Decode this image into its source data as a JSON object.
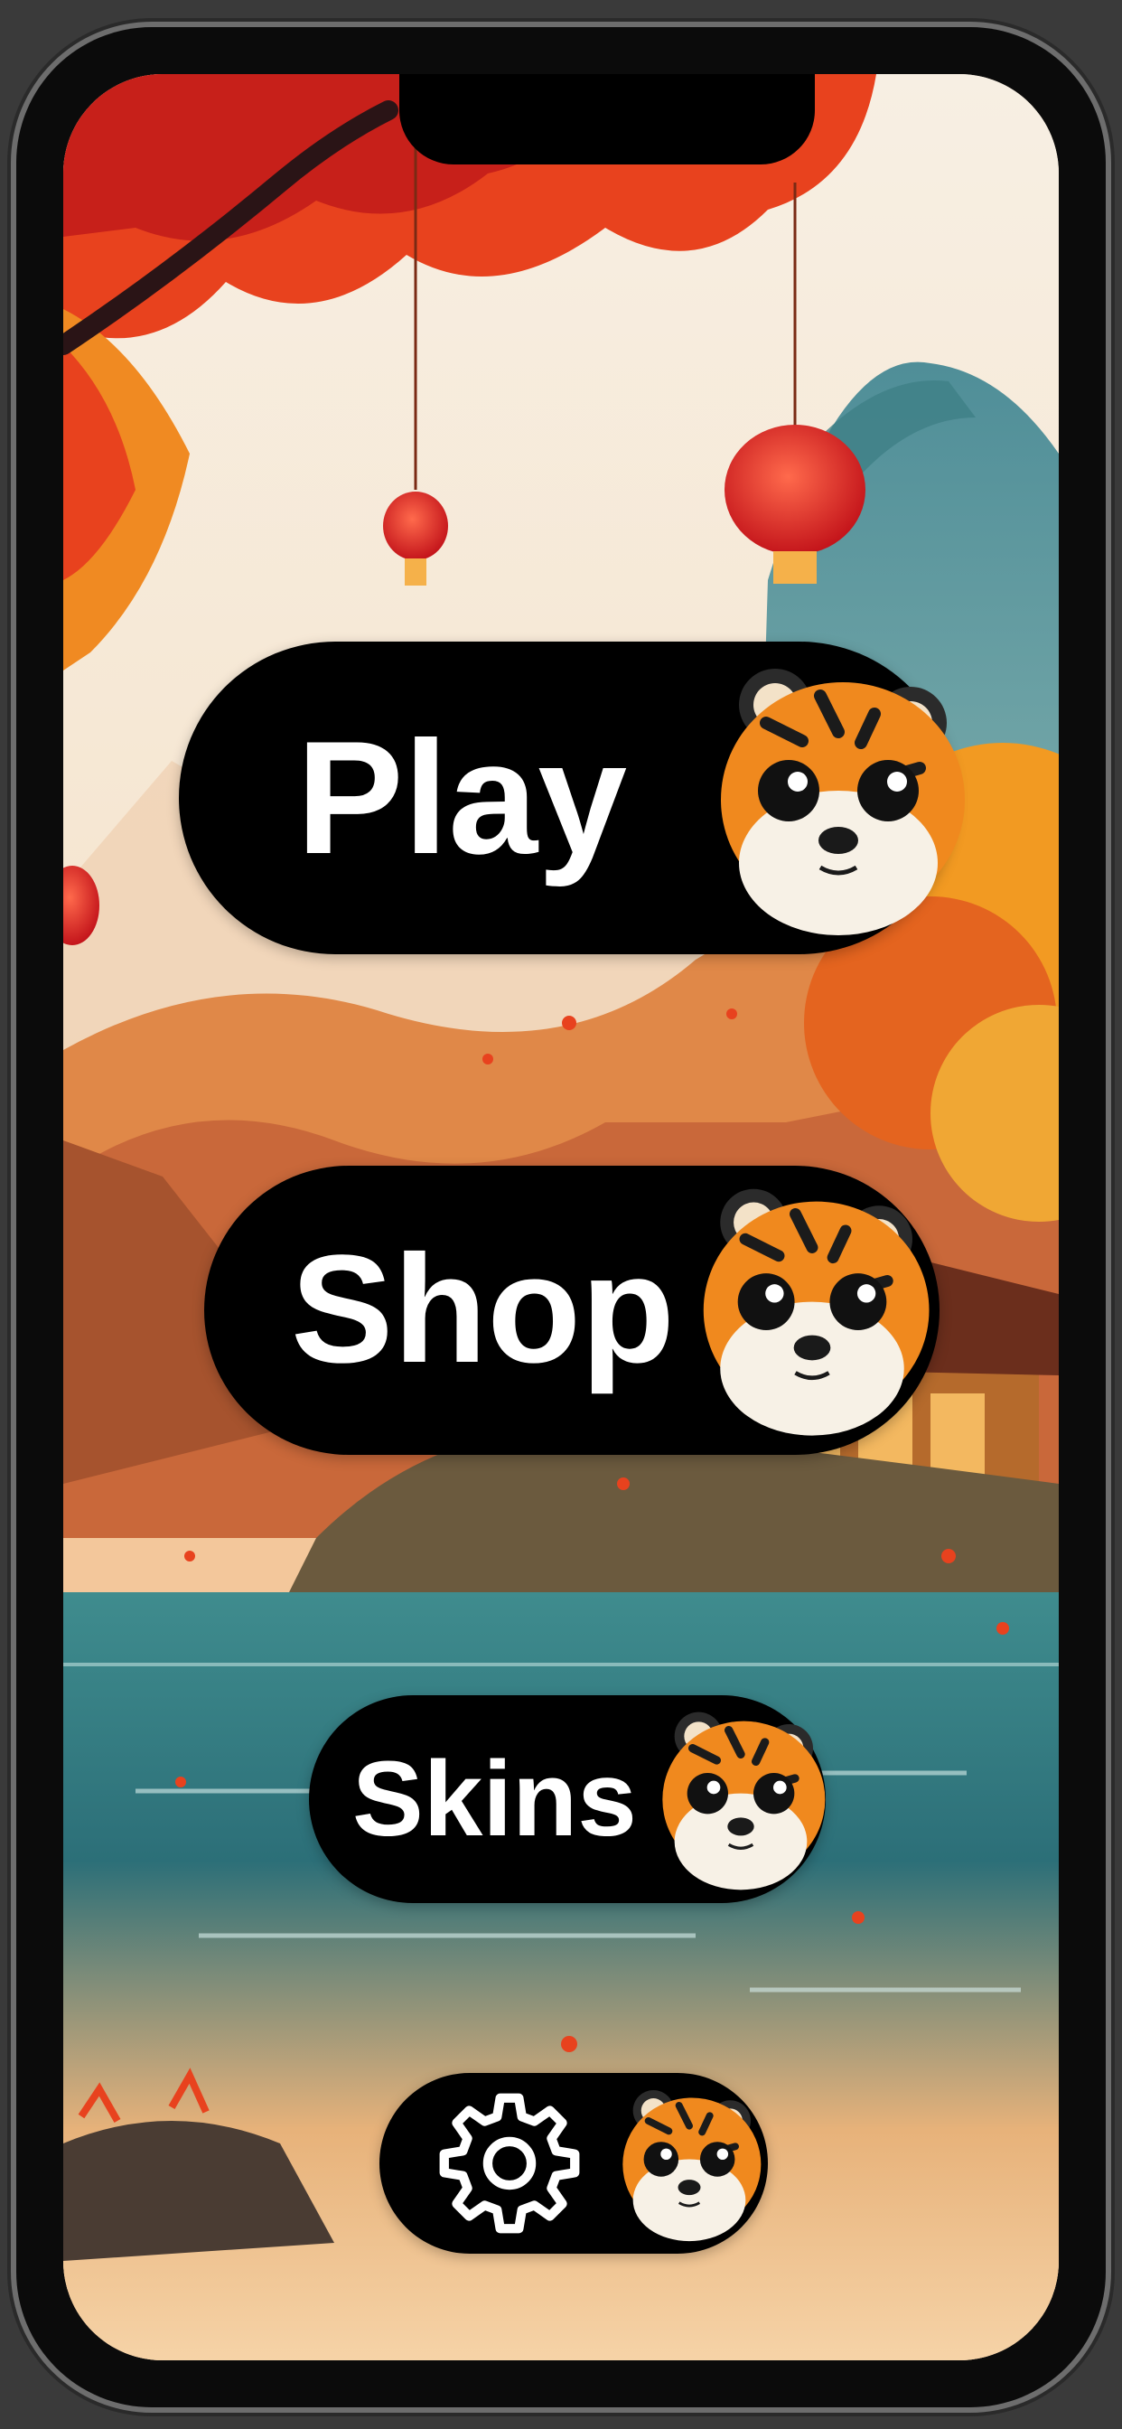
{
  "menu": {
    "play_label": "Play",
    "shop_label": "Shop",
    "skins_label": "Skins",
    "settings_icon": "gear-icon"
  },
  "mascot": "tiger-icon",
  "background": {
    "scene": "autumn-lake-landscape-with-lanterns",
    "colors": {
      "sky": "#f6efe4",
      "leaves": "#e8421e",
      "orange": "#f08a22",
      "water": "#2f7f86",
      "mountain": "#5fa2a8",
      "button": "#000000",
      "button_text": "#ffffff"
    }
  }
}
